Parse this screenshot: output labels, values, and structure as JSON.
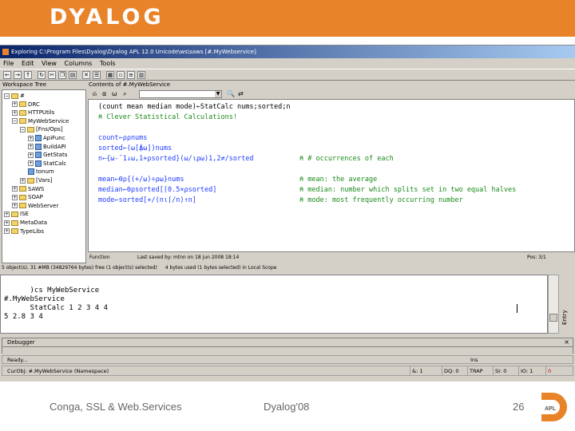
{
  "slide": {
    "logo": "DYALOG",
    "footer_left": "Conga, SSL & Web.Services",
    "footer_center": "Dyalog'08",
    "page_number": "26",
    "badge_text": "APL",
    "brand_color": "#e8832a"
  },
  "window": {
    "title": "Exploring C:\\Program Files\\Dyalog\\Dyalog APL 12.0 Unicode\\ws\\saws [#.MyWebservice]",
    "menus": [
      "File",
      "Edit",
      "View",
      "Columns",
      "Tools"
    ]
  },
  "workspace": {
    "tree_header": "Workspace Tree",
    "contents_header": "Contents of #.MyWebService",
    "tree": [
      {
        "label": "#",
        "indent": 0,
        "expander": "−",
        "kind": "folder"
      },
      {
        "label": "DRC",
        "indent": 1,
        "expander": "+",
        "kind": "folder"
      },
      {
        "label": "HTTPUtils",
        "indent": 1,
        "expander": "+",
        "kind": "folder"
      },
      {
        "label": "MyWebService",
        "indent": 1,
        "expander": "−",
        "kind": "folder"
      },
      {
        "label": "[Fns/Ops]",
        "indent": 2,
        "expander": "−",
        "kind": "folder"
      },
      {
        "label": "ApiFunc",
        "indent": 3,
        "expander": "+",
        "kind": "fn"
      },
      {
        "label": "BuildAPI",
        "indent": 3,
        "expander": "+",
        "kind": "fn"
      },
      {
        "label": "GetStats",
        "indent": 3,
        "expander": "+",
        "kind": "fn"
      },
      {
        "label": "StatCalc",
        "indent": 3,
        "expander": "+",
        "kind": "fn"
      },
      {
        "label": "tonum",
        "indent": 3,
        "expander": "",
        "kind": "fn"
      },
      {
        "label": "[Vars]",
        "indent": 2,
        "expander": "+",
        "kind": "folder"
      },
      {
        "label": "SAWS",
        "indent": 1,
        "expander": "+",
        "kind": "folder"
      },
      {
        "label": "SOAP",
        "indent": 1,
        "expander": "+",
        "kind": "folder"
      },
      {
        "label": "WebServer",
        "indent": 1,
        "expander": "+",
        "kind": "folder"
      },
      {
        "label": "ISE",
        "indent": 0,
        "expander": "+",
        "kind": "folder"
      },
      {
        "label": "MetaData",
        "indent": 0,
        "expander": "+",
        "kind": "folder"
      },
      {
        "label": "TypeLibs",
        "indent": 0,
        "expander": "+",
        "kind": "folder"
      }
    ],
    "status": "5 object(s), 31 #MB (34829764 bytes) free (1 object(s) selected)"
  },
  "editor": {
    "combo_value": "",
    "lines": [
      {
        "text": "(count mean median mode)←StatCalc nums;sorted;n",
        "color": "black"
      },
      {
        "text": "⍝ Clever Statistical Calculations!",
        "color": "comment"
      },
      {
        "text": "",
        "color": "black"
      },
      {
        "text": "count←⍴⍴nums",
        "color": "code"
      },
      {
        "text": "sorted←(⍵[⍋⍵])nums",
        "color": "code"
      },
      {
        "text": "n←{⍵-¯1↓⍵,1+⍴sorted}(⍵/⍳⍴⍵)1,2≠/sorted",
        "color": "code",
        "comment": "⍝ # occurrences of each"
      },
      {
        "text": "",
        "color": "black"
      },
      {
        "text": "mean←⍬⍴{(+/⍵)÷⍴⍵}nums",
        "color": "code",
        "comment": "⍝ mean: the average"
      },
      {
        "text": "median←⍬⍴sorted[⌈0.5×⍴sorted]",
        "color": "code",
        "comment": "⍝ median: number which splits set in two equal halves"
      },
      {
        "text": "mode←sorted[+/(n⍳⌈/n)↑n]",
        "color": "code",
        "comment": "⍝ mode: most frequently occurring number"
      }
    ],
    "status": {
      "kind": "Function",
      "saved": "Last saved by: mtnn on 18 jun 2008 18:14",
      "position": "Pos: 3/1"
    },
    "bytes_status": "4 bytes used (1 bytes selected) in Local Scope"
  },
  "session": {
    "lines": [
      "      )cs MyWebService",
      "#.MyWebService",
      "      StatCalc 1 2 3 4 4",
      "5 2.8 3 4"
    ],
    "entry_label": "Entry"
  },
  "debugger": {
    "label": "Debugger",
    "close": "×"
  },
  "status_bar": {
    "ready": "Ready...",
    "ins": "Ins",
    "current_object": "CurObj: #.MyWebService (Namespace)",
    "cells": [
      "&: 1",
      "DQ: 0",
      "TRAP",
      "SI: 0",
      "IO: 1",
      "0"
    ]
  }
}
